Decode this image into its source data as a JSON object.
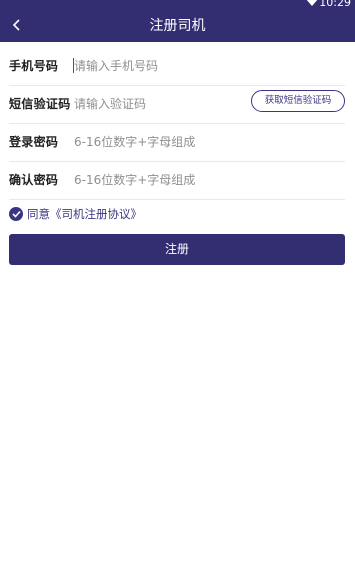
{
  "status_bar": {
    "time": "10:29"
  },
  "header": {
    "title": "注册司机"
  },
  "form": {
    "phone": {
      "label": "手机号码",
      "placeholder": "请输入手机号码"
    },
    "sms_code": {
      "label": "短信验证码",
      "placeholder": "请输入验证码",
      "button": "获取短信验证码"
    },
    "password": {
      "label": "登录密码",
      "placeholder": "6-16位数字+字母组成"
    },
    "confirm_password": {
      "label": "确认密码",
      "placeholder": "6-16位数字+字母组成"
    }
  },
  "agreement": {
    "checked": true,
    "text": "同意《司机注册协议》"
  },
  "submit": {
    "label": "注册"
  },
  "colors": {
    "primary": "#332d72",
    "accent": "#3b3683"
  }
}
